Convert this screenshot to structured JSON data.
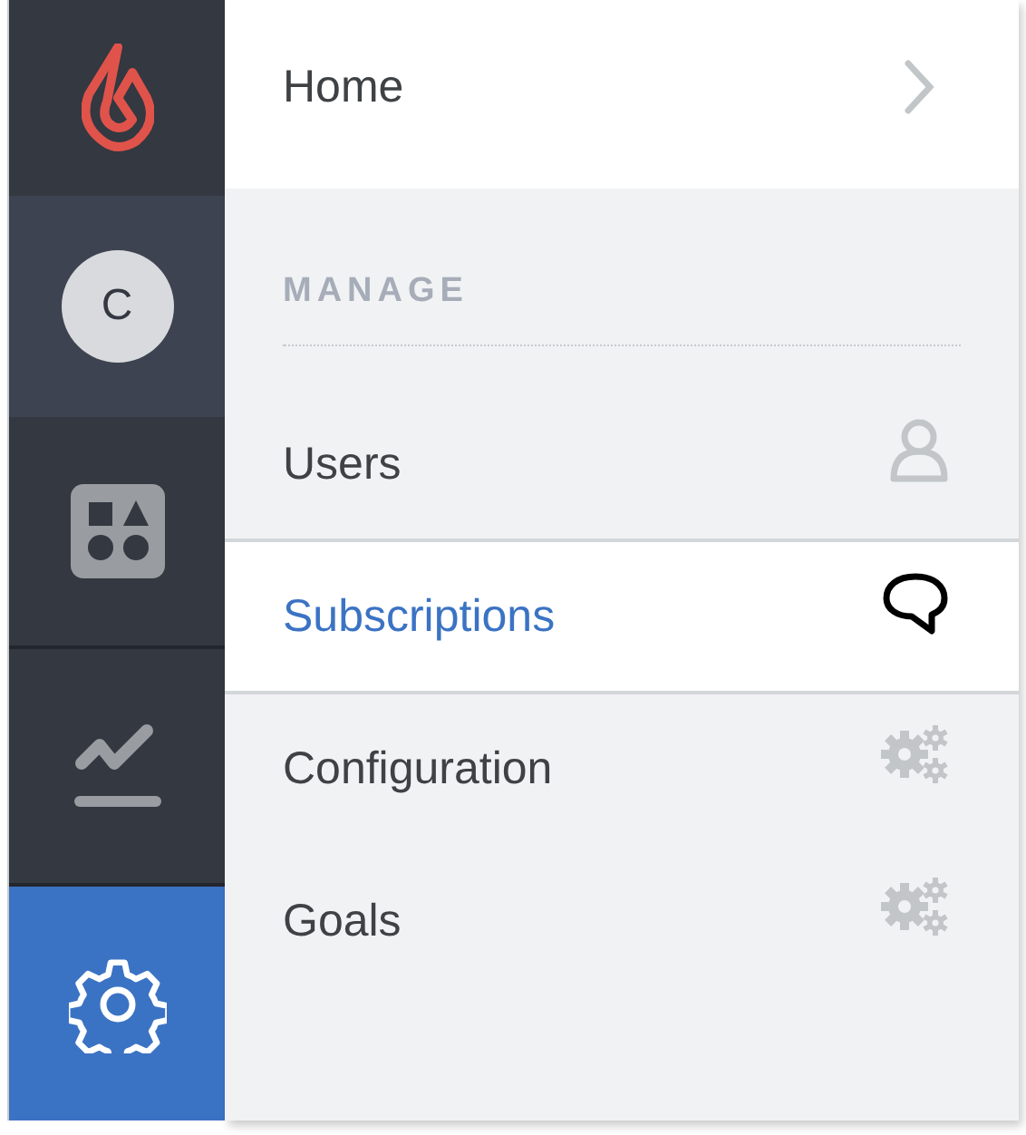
{
  "rail": [
    {
      "kind": "logo",
      "selected": false
    },
    {
      "kind": "avatar",
      "initial": "C",
      "selected": false
    },
    {
      "kind": "apps",
      "selected": false
    },
    {
      "kind": "analytics",
      "selected": false
    },
    {
      "kind": "settings",
      "selected": true
    }
  ],
  "menu": {
    "home": {
      "label": "Home"
    },
    "section": "MANAGE",
    "items": [
      {
        "label": "Users",
        "kind": "person",
        "selected": false
      },
      {
        "label": "Subscriptions",
        "kind": "chat",
        "selected": true
      },
      {
        "label": "Configuration",
        "kind": "gears",
        "selected": false
      },
      {
        "label": "Goals",
        "kind": "gears",
        "selected": false
      }
    ]
  }
}
